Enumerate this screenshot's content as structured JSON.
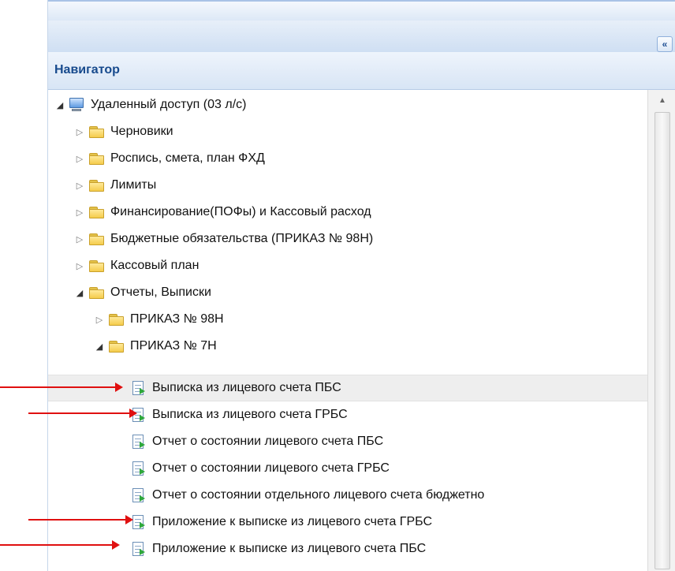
{
  "panel": {
    "collapse_glyph": "«",
    "title": "Навигатор"
  },
  "colors": {
    "header_text": "#174a8d",
    "arrow": "#e01010",
    "selection": "#eeeeee"
  },
  "tree": {
    "items": [
      {
        "label": "Удаленный доступ (03 л/с)",
        "icon": "computer-icon",
        "expander": "open"
      },
      {
        "label": "Черновики",
        "icon": "folder-icon",
        "expander": "closed"
      },
      {
        "label": "Роспись, смета, план ФХД",
        "icon": "folder-icon",
        "expander": "closed"
      },
      {
        "label": "Лимиты",
        "icon": "folder-icon",
        "expander": "closed"
      },
      {
        "label": "Финансирование(ПОФы) и Кассовый расход",
        "icon": "folder-icon",
        "expander": "closed"
      },
      {
        "label": "Бюджетные обязательства (ПРИКАЗ № 98Н)",
        "icon": "folder-icon",
        "expander": "closed"
      },
      {
        "label": "Кассовый план",
        "icon": "folder-icon",
        "expander": "closed"
      },
      {
        "label": "Отчеты, Выписки",
        "icon": "folder-icon",
        "expander": "open"
      },
      {
        "label": "ПРИКАЗ № 98Н",
        "icon": "folder-icon",
        "expander": "closed"
      },
      {
        "label": "ПРИКАЗ № 7Н",
        "icon": "folder-icon",
        "expander": "open"
      },
      {
        "label": "Выписка из лицевого счета ПБС",
        "icon": "report-doc-icon",
        "selected": true
      },
      {
        "label": "Выписка из лицевого счета ГРБС",
        "icon": "report-doc-icon"
      },
      {
        "label": "Отчет о состоянии лицевого счета ПБС",
        "icon": "report-doc-icon"
      },
      {
        "label": "Отчет о состоянии лицевого счета ГРБС",
        "icon": "report-doc-icon"
      },
      {
        "label": "Отчет о состоянии отдельного лицевого счета бюджетно",
        "icon": "report-doc-icon"
      },
      {
        "label": "Приложение к выписке из лицевого счета ГРБС",
        "icon": "report-doc-icon"
      },
      {
        "label": "Приложение к выписке из лицевого счета ПБС",
        "icon": "report-doc-icon"
      }
    ]
  },
  "scrollbar": {
    "up_glyph": "▲"
  }
}
